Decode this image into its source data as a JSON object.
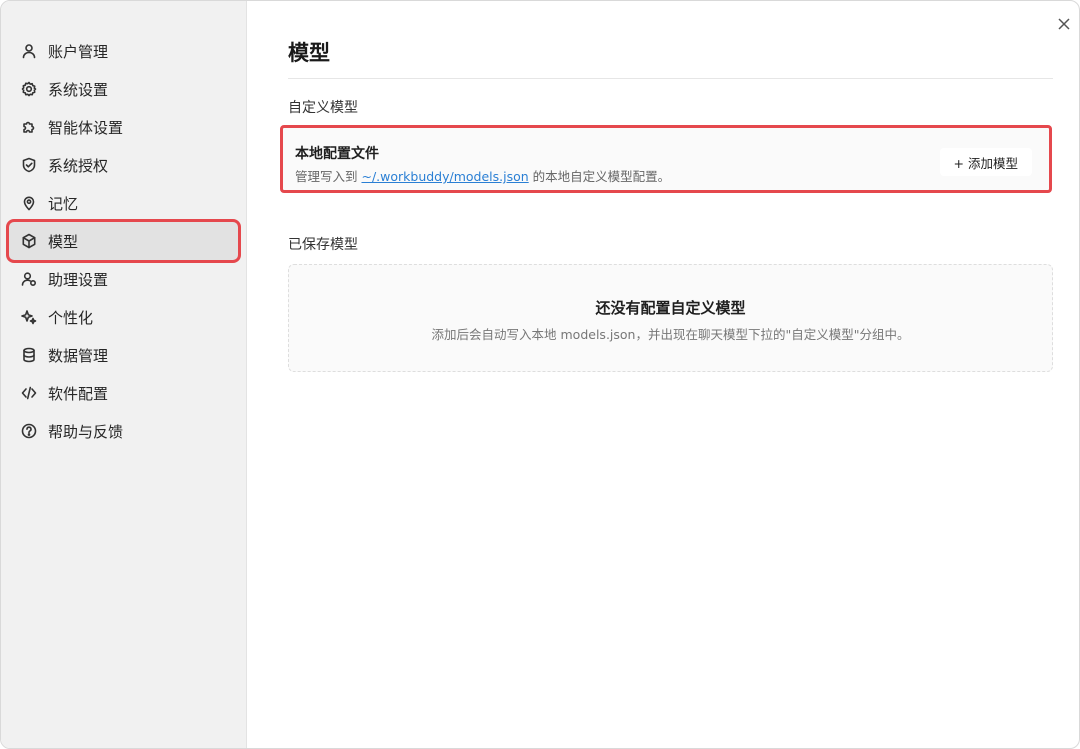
{
  "sidebar": {
    "items": [
      {
        "label": "账户管理",
        "icon": "user-icon"
      },
      {
        "label": "系统设置",
        "icon": "gear-icon"
      },
      {
        "label": "智能体设置",
        "icon": "puzzle-icon"
      },
      {
        "label": "系统授权",
        "icon": "shield-check-icon"
      },
      {
        "label": "记忆",
        "icon": "location-pin-icon"
      },
      {
        "label": "模型",
        "icon": "cube-icon",
        "active": true
      },
      {
        "label": "助理设置",
        "icon": "user-gear-icon"
      },
      {
        "label": "个性化",
        "icon": "sparkle-icon"
      },
      {
        "label": "数据管理",
        "icon": "database-icon"
      },
      {
        "label": "软件配置",
        "icon": "code-icon"
      },
      {
        "label": "帮助与反馈",
        "icon": "question-circle-icon"
      }
    ]
  },
  "main": {
    "title": "模型",
    "custom_section": {
      "label": "自定义模型",
      "card": {
        "title": "本地配置文件",
        "desc_prefix": "管理写入到 ",
        "desc_link": "~/.workbuddy/models.json",
        "desc_suffix": " 的本地自定义模型配置。",
        "add_button": "+ 添加模型"
      }
    },
    "saved_section": {
      "label": "已保存模型",
      "empty_title": "还没有配置自定义模型",
      "empty_desc": "添加后会自动写入本地 models.json，并出现在聊天模型下拉的\"自定义模型\"分组中。"
    }
  },
  "colors": {
    "highlight": "#e5484d",
    "link": "#2a7fd4",
    "sidebar_bg": "#f1f1f1"
  }
}
